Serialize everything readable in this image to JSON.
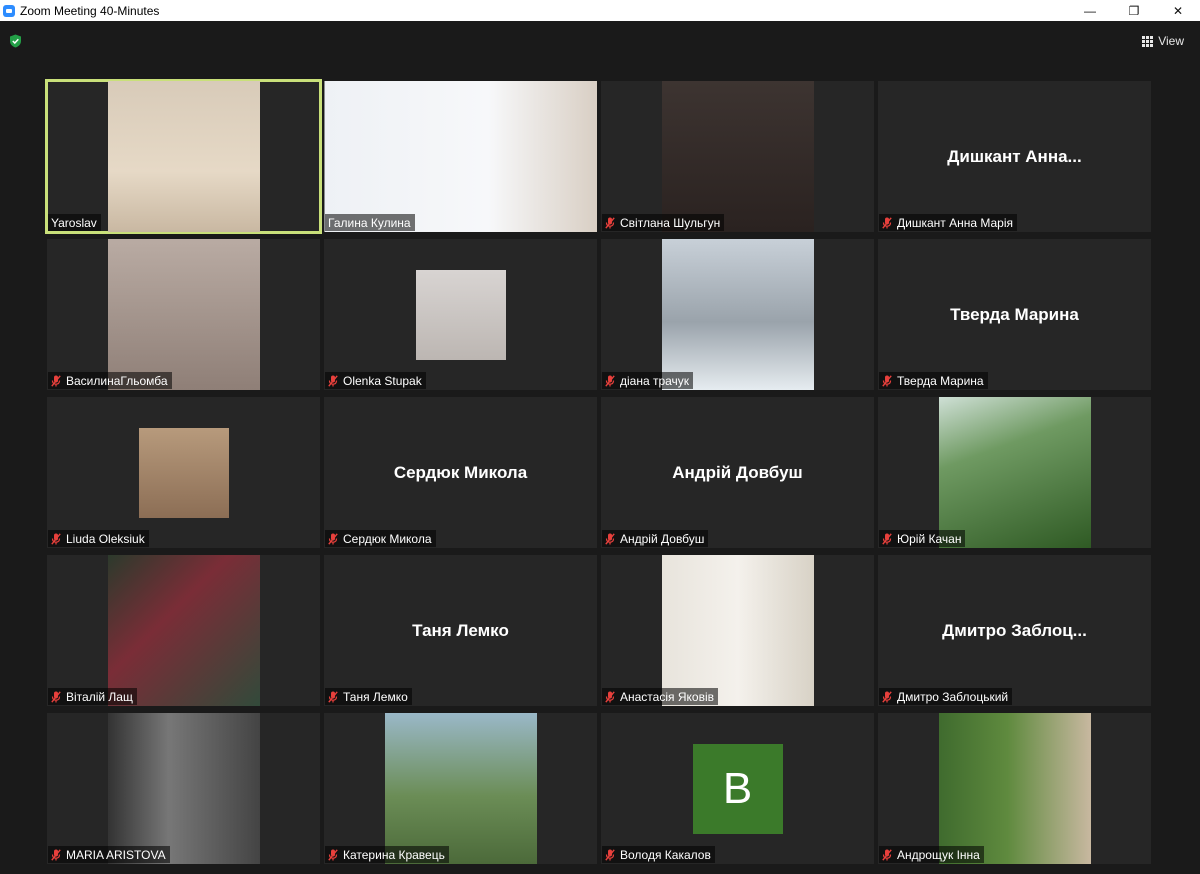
{
  "window": {
    "title": "Zoom Meeting 40-Minutes",
    "min_glyph": "—",
    "restore_glyph": "❐",
    "close_glyph": "✕"
  },
  "toolbar": {
    "view_label": "View",
    "security_icon": "shield-check-icon",
    "security_color": "#23a047"
  },
  "colors": {
    "active_speaker_border": "#c9e07a",
    "tile_bg": "#262626",
    "muted_icon": "#e8403c",
    "avatar_bg": "#3b7a2a"
  },
  "participants": [
    {
      "name": "Yaroslav",
      "muted": false,
      "kind": "video",
      "active": true
    },
    {
      "name": "Галина Кулина",
      "muted": false,
      "kind": "video"
    },
    {
      "name": "Світлана Шульгун",
      "muted": true,
      "kind": "video"
    },
    {
      "name": "Дишкант Анна Марія",
      "muted": true,
      "kind": "name",
      "display": "Дишкант  Анна..."
    },
    {
      "name": "ВасилинаГльомба",
      "muted": true,
      "kind": "video"
    },
    {
      "name": "Olenka Stupak",
      "muted": true,
      "kind": "photo"
    },
    {
      "name": "діана трачук",
      "muted": true,
      "kind": "video"
    },
    {
      "name": "Тверда Марина",
      "muted": true,
      "kind": "name",
      "display": "Тверда Марина"
    },
    {
      "name": "Liuda Oleksiuk",
      "muted": true,
      "kind": "photo"
    },
    {
      "name": "Сердюк Микола",
      "muted": true,
      "kind": "name",
      "display": "Сердюк Микола"
    },
    {
      "name": "Андрій Довбуш",
      "muted": true,
      "kind": "name",
      "display": "Андрій Довбуш"
    },
    {
      "name": "Юрій Качан",
      "muted": true,
      "kind": "video"
    },
    {
      "name": "Віталій Лащ",
      "muted": true,
      "kind": "video"
    },
    {
      "name": "Таня Лемко",
      "muted": true,
      "kind": "name",
      "display": "Таня Лемко"
    },
    {
      "name": "Анастасія Яковів",
      "muted": true,
      "kind": "video"
    },
    {
      "name": "Дмитро Заблоцький",
      "muted": true,
      "kind": "name",
      "display": "Дмитро  Заблоц..."
    },
    {
      "name": "MARIA ARISTOVA",
      "muted": true,
      "kind": "video"
    },
    {
      "name": "Катерина Кравець",
      "muted": true,
      "kind": "video"
    },
    {
      "name": "Володя Какалов",
      "muted": true,
      "kind": "avatar",
      "display": "B"
    },
    {
      "name": "Андрощук Інна",
      "muted": true,
      "kind": "video"
    }
  ]
}
